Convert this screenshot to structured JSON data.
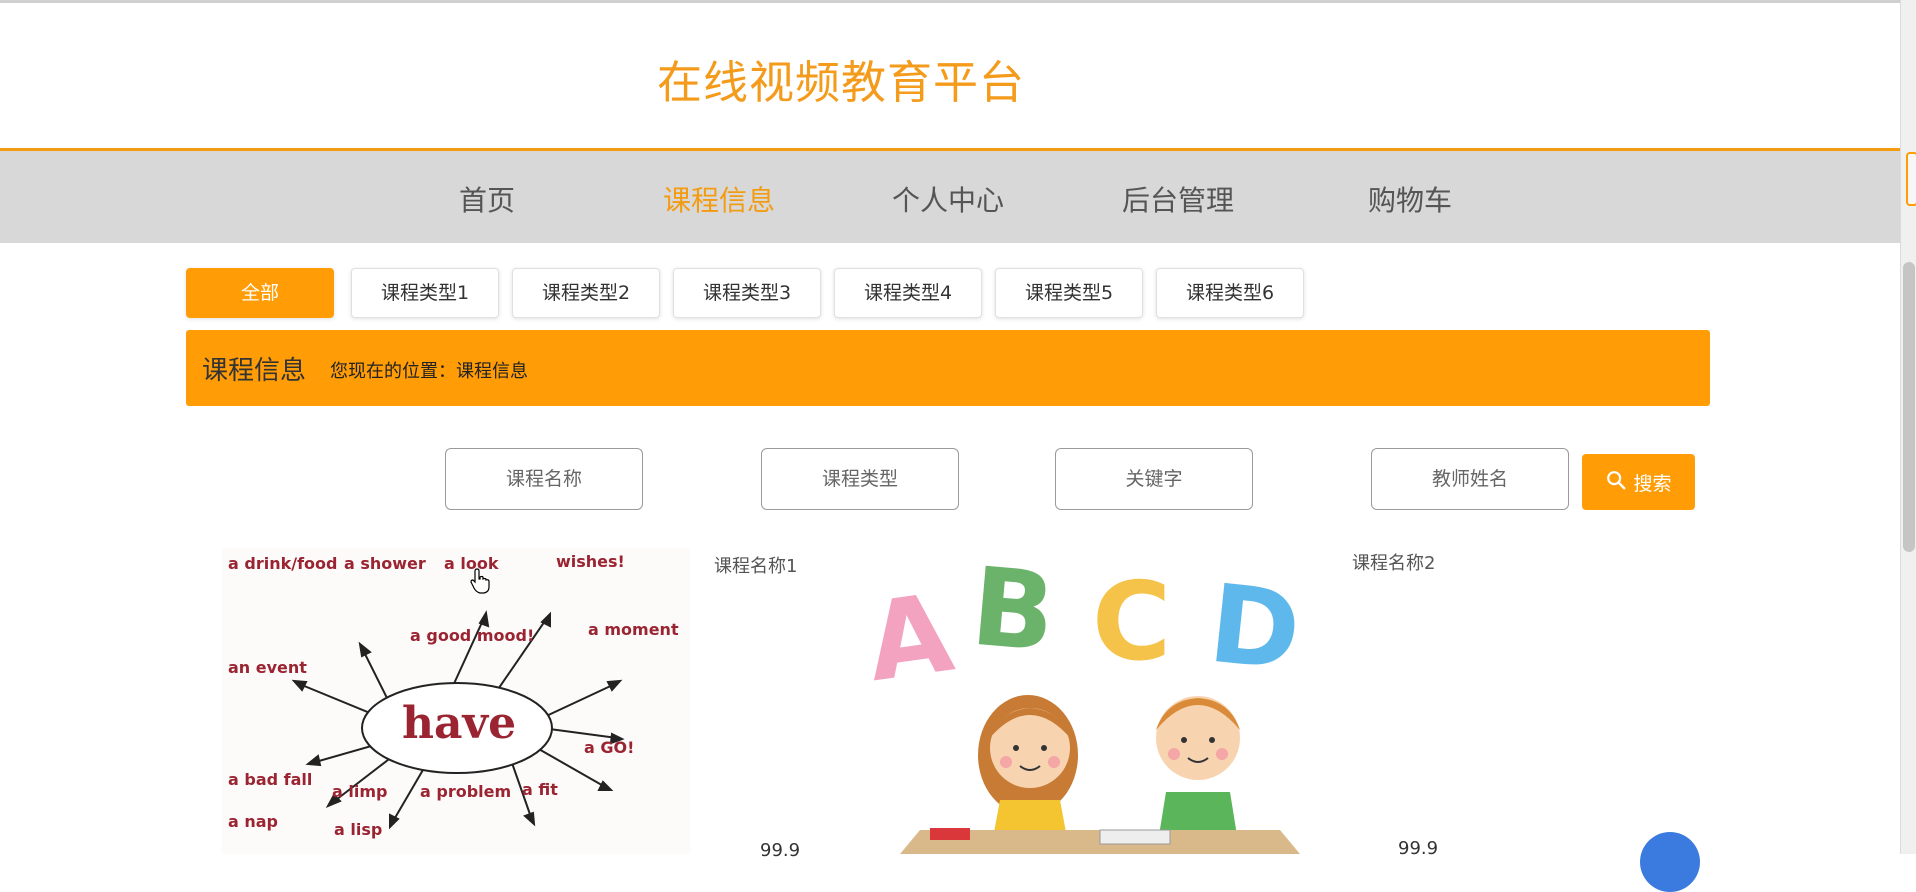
{
  "site": {
    "title": "在线视频教育平台"
  },
  "nav": [
    {
      "label": "首页"
    },
    {
      "label": "课程信息"
    },
    {
      "label": "个人中心"
    },
    {
      "label": "后台管理"
    },
    {
      "label": "购物车"
    }
  ],
  "nav_active": "课程信息",
  "tabs": [
    {
      "label": "全部"
    },
    {
      "label": "课程类型1"
    },
    {
      "label": "课程类型2"
    },
    {
      "label": "课程类型3"
    },
    {
      "label": "课程类型4"
    },
    {
      "label": "课程类型5"
    },
    {
      "label": "课程类型6"
    }
  ],
  "banner": {
    "title": "课程信息",
    "location": "您现在的位置：课程信息"
  },
  "search": {
    "course_name_placeholder": "课程名称",
    "course_type_placeholder": "课程类型",
    "keyword_placeholder": "关键字",
    "teacher_placeholder": "教师姓名",
    "button_label": "搜索"
  },
  "courses": [
    {
      "name": "课程名称1",
      "price": "99.9",
      "image_words": [
        "a drink/food",
        "a shower",
        "a look",
        "wishes!",
        "a good mood!",
        "a moment",
        "an event",
        "have",
        "a GO!",
        "a bad fall",
        "a limp",
        "a problem",
        "a fit",
        "a nap",
        "a lisp"
      ]
    },
    {
      "name": "课程名称2",
      "price": "99.9",
      "image_letters": [
        "A",
        "B",
        "C",
        "D"
      ]
    }
  ],
  "colors": {
    "accent": "#ff9c06",
    "nav_bg": "#d8d8d8",
    "title": "#f49b1c"
  }
}
